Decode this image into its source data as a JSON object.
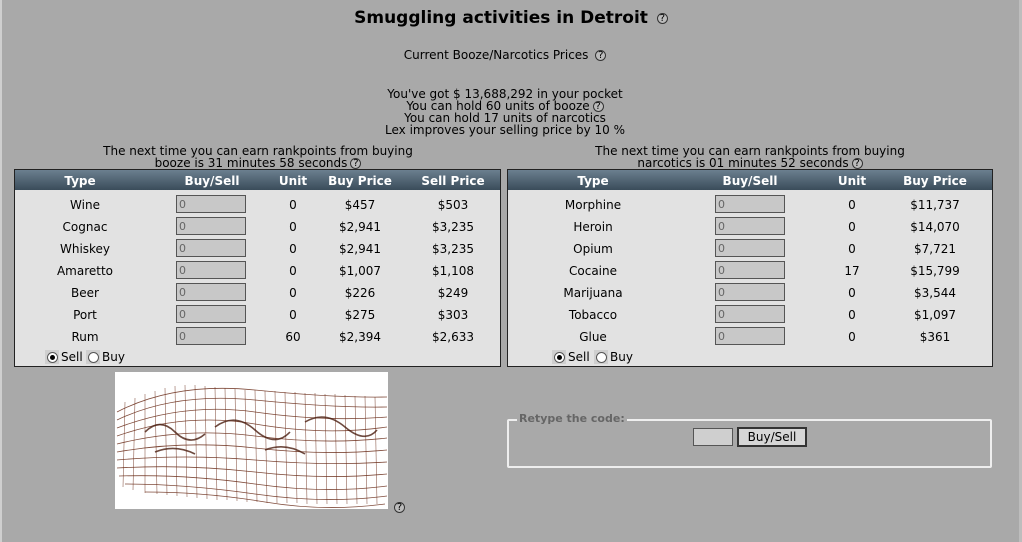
{
  "title": "Smuggling activities in Detroit",
  "subtitle": "Current Booze/Narcotics Prices",
  "info": {
    "pocket": "You've got $ 13,688,292 in your pocket",
    "hold_booze": "You can hold 60 units of booze",
    "hold_narcotics": "You can hold 17 units of narcotics",
    "lex": "Lex improves your selling price by 10 %"
  },
  "booze": {
    "next_line1": "The next time you can earn rankpoints from buying",
    "next_line2": "booze is 31 minutes 58 seconds",
    "headers": {
      "type": "Type",
      "buysell": "Buy/Sell",
      "unit": "Unit",
      "buy": "Buy Price",
      "sell": "Sell Price"
    },
    "rows": [
      {
        "type": "Wine",
        "value": "0",
        "unit": "0",
        "buy": "$457",
        "sell": "$503"
      },
      {
        "type": "Cognac",
        "value": "0",
        "unit": "0",
        "buy": "$2,941",
        "sell": "$3,235"
      },
      {
        "type": "Whiskey",
        "value": "0",
        "unit": "0",
        "buy": "$2,941",
        "sell": "$3,235"
      },
      {
        "type": "Amaretto",
        "value": "0",
        "unit": "0",
        "buy": "$1,007",
        "sell": "$1,108"
      },
      {
        "type": "Beer",
        "value": "0",
        "unit": "0",
        "buy": "$226",
        "sell": "$249"
      },
      {
        "type": "Port",
        "value": "0",
        "unit": "0",
        "buy": "$275",
        "sell": "$303"
      },
      {
        "type": "Rum",
        "value": "0",
        "unit": "60",
        "buy": "$2,394",
        "sell": "$2,633"
      }
    ],
    "sell_label": "Sell",
    "buy_label": "Buy"
  },
  "narcotics": {
    "next_line1": "The next time you can earn rankpoints from buying",
    "next_line2": "narcotics is 01 minutes 52 seconds",
    "headers": {
      "type": "Type",
      "buysell": "Buy/Sell",
      "unit": "Unit",
      "buy": "Buy Price"
    },
    "rows": [
      {
        "type": "Morphine",
        "value": "0",
        "unit": "0",
        "buy": "$11,737"
      },
      {
        "type": "Heroin",
        "value": "0",
        "unit": "0",
        "buy": "$14,070"
      },
      {
        "type": "Opium",
        "value": "0",
        "unit": "0",
        "buy": "$7,721"
      },
      {
        "type": "Cocaine",
        "value": "0",
        "unit": "17",
        "buy": "$15,799"
      },
      {
        "type": "Marijuana",
        "value": "0",
        "unit": "0",
        "buy": "$3,544"
      },
      {
        "type": "Tobacco",
        "value": "0",
        "unit": "0",
        "buy": "$1,097"
      },
      {
        "type": "Glue",
        "value": "0",
        "unit": "0",
        "buy": "$361"
      }
    ],
    "sell_label": "Sell",
    "buy_label": "Buy"
  },
  "code": {
    "legend": "Retype the code:",
    "button": "Buy/Sell",
    "input_value": ""
  },
  "help_icon": "?",
  "icons": {
    "help": "question-icon",
    "radio": "radio-icon"
  },
  "colors": {
    "background": "#a9a9a9",
    "header": "#3a4c5a",
    "panel": "#e2e2e2",
    "captcha_stroke": "#6b2d1a"
  }
}
